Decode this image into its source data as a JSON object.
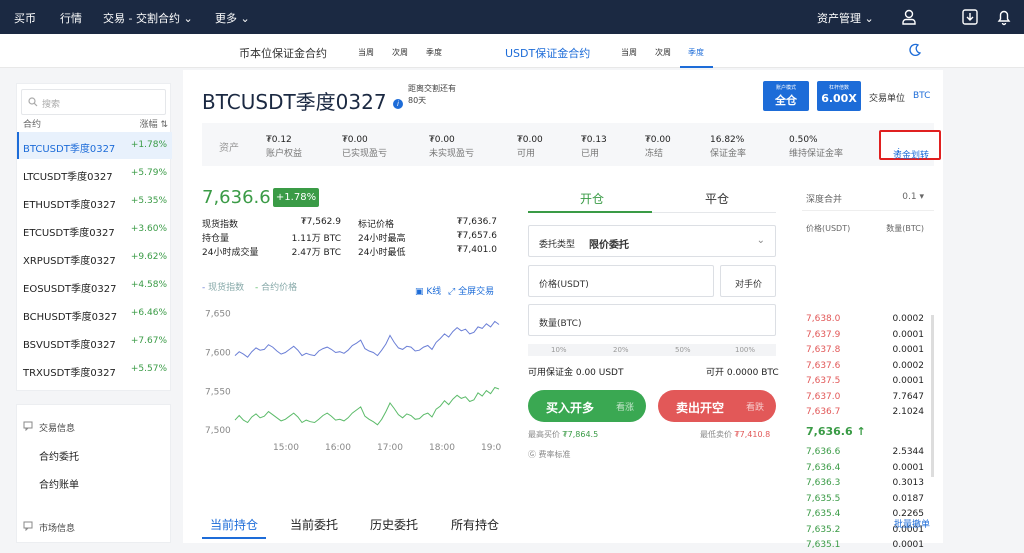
{
  "topnav": {
    "items": [
      "买币",
      "行情",
      "交易 - 交割合约",
      "更多"
    ],
    "asset_mgmt": "资产管理"
  },
  "subnav": {
    "coin_margin": "币本位保证金合约",
    "coin_periods": [
      "当周",
      "次周",
      "季度"
    ],
    "usdt_margin": "USDT保证金合约",
    "usdt_periods": [
      "当周",
      "次周",
      "季度"
    ],
    "active_period": "季度"
  },
  "sidebar": {
    "search_placeholder": "搜索",
    "col_contract": "合约",
    "col_change": "涨幅",
    "items": [
      {
        "name": "BTCUSDT季度0327",
        "change": "+1.78%"
      },
      {
        "name": "LTCUSDT季度0327",
        "change": "+5.79%"
      },
      {
        "name": "ETHUSDT季度0327",
        "change": "+5.35%"
      },
      {
        "name": "ETCUSDT季度0327",
        "change": "+3.60%"
      },
      {
        "name": "XRPUSDT季度0327",
        "change": "+9.62%"
      },
      {
        "name": "EOSUSDT季度0327",
        "change": "+4.58%"
      },
      {
        "name": "BCHUSDT季度0327",
        "change": "+6.46%"
      },
      {
        "name": "BSVUSDT季度0327",
        "change": "+7.67%"
      },
      {
        "name": "TRXUSDT季度0327",
        "change": "+5.57%"
      }
    ],
    "trade_info": "交易信息",
    "trade_links": [
      "合约委托",
      "合约账单"
    ],
    "market_info": "市场信息"
  },
  "header": {
    "title": "BTCUSDT季度0327",
    "delivery_label": "距离交割还有",
    "delivery_value": "80天",
    "mode_small": "账户模式",
    "mode_value": "全仓",
    "lev_small": "杠杆倍数",
    "lev_value": "6.00X",
    "unit_label": "交易单位",
    "unit_value": "BTC"
  },
  "assets": {
    "label": "资产",
    "cols": [
      {
        "value": "₮0.12",
        "key": "账户权益"
      },
      {
        "value": "₮0.00",
        "key": "已实现盈亏"
      },
      {
        "value": "₮0.00",
        "key": "未实现盈亏"
      },
      {
        "value": "₮0.00",
        "key": "可用"
      },
      {
        "value": "₮0.13",
        "key": "已用"
      },
      {
        "value": "₮0.00",
        "key": "冻结"
      },
      {
        "value": "16.82%",
        "key": "保证金率"
      },
      {
        "value": "0.50%",
        "key": "维持保证金率"
      }
    ],
    "transfer": "资金划转"
  },
  "ticker": {
    "price": "7,636.6",
    "change": "+1.78%",
    "stats": [
      {
        "k": "现货指数",
        "v": "₮7,562.9"
      },
      {
        "k": "持仓量",
        "v": "1.11万 BTC"
      },
      {
        "k": "24小时成交量",
        "v": "2.47万 BTC"
      },
      {
        "k": "标记价格",
        "v": "₮7,636.7"
      },
      {
        "k": "24小时最高",
        "v": "₮7,657.6"
      },
      {
        "k": "24小时最低",
        "v": "₮7,401.0"
      }
    ]
  },
  "chart_data": {
    "type": "line",
    "legend": [
      "现货指数",
      "合约价格"
    ],
    "links": [
      "K线",
      "全屏交易"
    ],
    "x_ticks": [
      "15:00",
      "16:00",
      "17:00",
      "18:00",
      "19:0"
    ],
    "y_ticks": [
      "7,650",
      "7,600",
      "7,550",
      "7,500"
    ],
    "ylim": [
      7490,
      7665
    ],
    "series": [
      {
        "name": "合约价格",
        "color": "#6b7fd6",
        "values": [
          7596,
          7601,
          7598,
          7594,
          7601,
          7606,
          7603,
          7604,
          7610,
          7607,
          7602,
          7598,
          7600,
          7604,
          7608,
          7603,
          7596,
          7599,
          7597,
          7596,
          7602,
          7605,
          7607,
          7604,
          7600,
          7601,
          7599,
          7603,
          7609,
          7612,
          7616,
          7605,
          7602,
          7600,
          7596,
          7603,
          7611,
          7622,
          7613,
          7606,
          7604,
          7608,
          7607,
          7602,
          7603,
          7607,
          7609,
          7604,
          7613,
          7618,
          7624,
          7620,
          7627,
          7632,
          7628,
          7630,
          7624,
          7626,
          7633,
          7631,
          7637,
          7633,
          7640,
          7636
        ]
      },
      {
        "name": "现货指数",
        "color": "#5cbb6a",
        "values": [
          7513,
          7519,
          7513,
          7510,
          7517,
          7521,
          7516,
          7518,
          7524,
          7520,
          7516,
          7512,
          7514,
          7518,
          7522,
          7517,
          7510,
          7513,
          7511,
          7510,
          7514,
          7519,
          7522,
          7518,
          7513,
          7514,
          7512,
          7516,
          7522,
          7526,
          7530,
          7518,
          7514,
          7511,
          7507,
          7514,
          7524,
          7535,
          7528,
          7520,
          7516,
          7521,
          7519,
          7514,
          7515,
          7520,
          7522,
          7517,
          7527,
          7531,
          7538,
          7533,
          7540,
          7545,
          7541,
          7543,
          7537,
          7539,
          7548,
          7544,
          7551,
          7547,
          7555,
          7553
        ]
      }
    ]
  },
  "trade": {
    "tab_open": "开仓",
    "tab_close": "平仓",
    "order_type_label": "委托类型",
    "order_type_value": "限价委托",
    "price_label": "价格(USDT)",
    "counter_price": "对手价",
    "qty_label": "数量(BTC)",
    "percents": [
      "10%",
      "20%",
      "50%",
      "100%"
    ],
    "avail_margin": "可用保证金 0.00 USDT",
    "avail_open": "可开 0.0000 BTC",
    "buy_label": "买入开多",
    "buy_sub": "看涨",
    "sell_label": "卖出开空",
    "sell_sub": "看跌",
    "best_bid_label": "最高买价",
    "best_bid": "₮7,864.5",
    "best_ask_label": "最低卖价",
    "best_ask": "₮7,410.8",
    "fee_link": "费率标准"
  },
  "depth": {
    "merge_label": "深度合并",
    "merge_value": "0.1",
    "col_price": "价格(USDT)",
    "col_qty": "数量(BTC)",
    "asks": [
      {
        "p": "7,638.0",
        "q": "0.0002"
      },
      {
        "p": "7,637.9",
        "q": "0.0001"
      },
      {
        "p": "7,637.8",
        "q": "0.0001"
      },
      {
        "p": "7,637.6",
        "q": "0.0002"
      },
      {
        "p": "7,637.5",
        "q": "0.0001"
      },
      {
        "p": "7,637.0",
        "q": "7.7647"
      },
      {
        "p": "7,636.7",
        "q": "2.1024"
      }
    ],
    "last": "7,636.6",
    "bids": [
      {
        "p": "7,636.6",
        "q": "2.5344"
      },
      {
        "p": "7,636.4",
        "q": "0.0001"
      },
      {
        "p": "7,636.3",
        "q": "0.3013"
      },
      {
        "p": "7,635.5",
        "q": "0.0187"
      },
      {
        "p": "7,635.4",
        "q": "0.2265"
      },
      {
        "p": "7,635.2",
        "q": "0.0001"
      },
      {
        "p": "7,635.1",
        "q": "0.0001"
      }
    ]
  },
  "bottom_tabs": [
    "当前持仓",
    "当前委托",
    "历史委托",
    "所有持仓"
  ],
  "batch_cancel": "批量撤单"
}
